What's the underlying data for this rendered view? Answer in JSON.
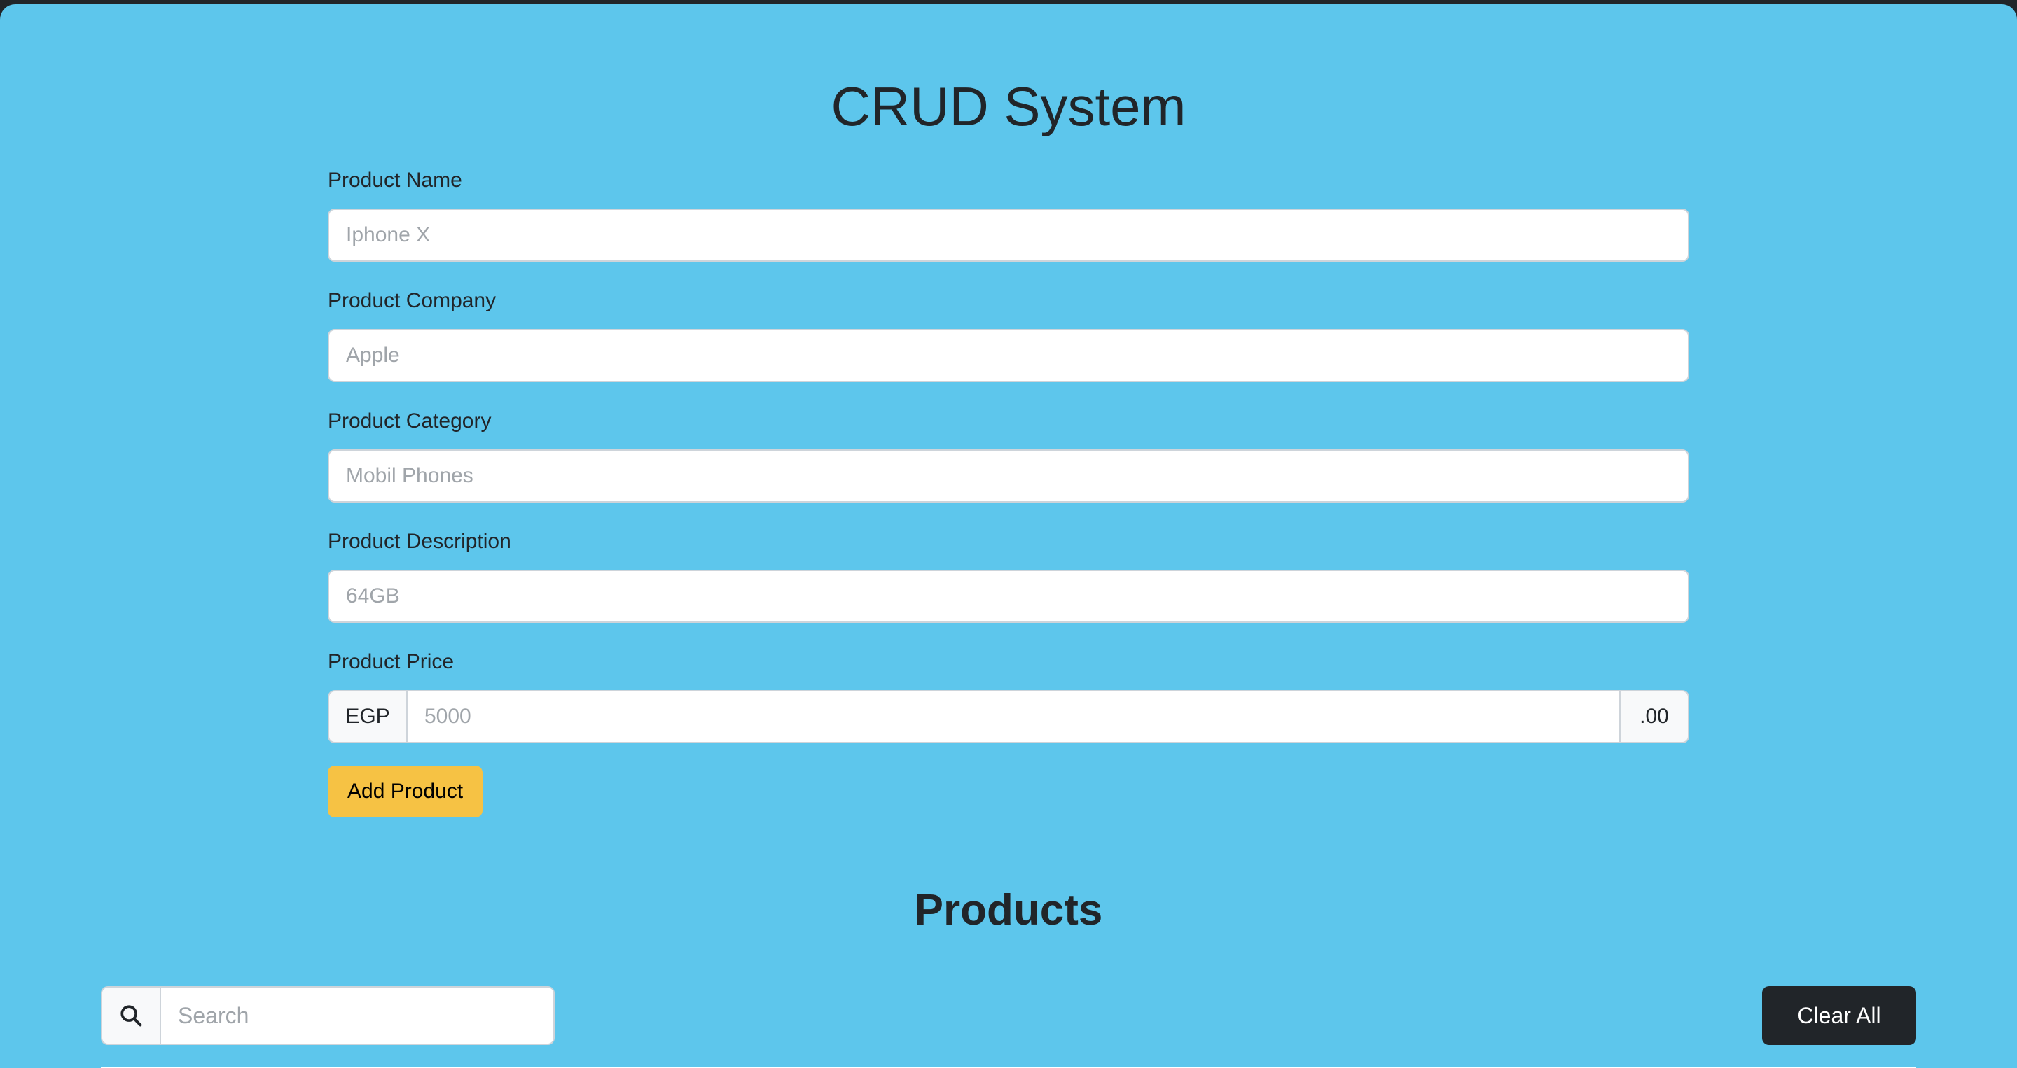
{
  "header": {
    "title": "CRUD System"
  },
  "form": {
    "name": {
      "label": "Product Name",
      "placeholder": "Iphone X"
    },
    "company": {
      "label": "Product Company",
      "placeholder": "Apple"
    },
    "category": {
      "label": "Product Category",
      "placeholder": "Mobil Phones"
    },
    "description": {
      "label": "Product Description",
      "placeholder": "64GB"
    },
    "price": {
      "label": "Product Price",
      "prefix": "EGP",
      "placeholder": "5000",
      "suffix": ".00"
    },
    "add_button": "Add Product"
  },
  "products": {
    "title": "Products",
    "search_placeholder": "Search",
    "search_icon": "magnifier-icon",
    "clear_button": "Clear All"
  },
  "colors": {
    "page_background": "#5dc6ec",
    "add_button": "#f6c244",
    "clear_button": "#212529"
  }
}
